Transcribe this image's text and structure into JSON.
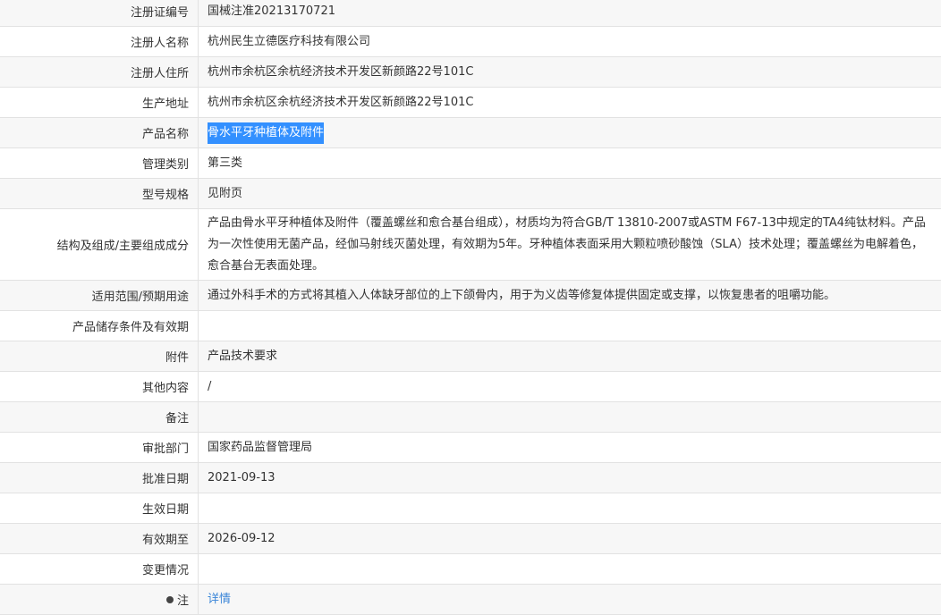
{
  "rows": [
    {
      "label": "注册证编号",
      "value": "国械注准20213170721"
    },
    {
      "label": "注册人名称",
      "value": "杭州民生立德医疗科技有限公司"
    },
    {
      "label": "注册人住所",
      "value": "杭州市余杭区余杭经济技术开发区新颜路22号101C"
    },
    {
      "label": "生产地址",
      "value": "杭州市余杭区余杭经济技术开发区新颜路22号101C"
    },
    {
      "label": "产品名称",
      "value": "骨水平牙种植体及附件"
    },
    {
      "label": "管理类别",
      "value": "第三类"
    },
    {
      "label": "型号规格",
      "value": "见附页"
    },
    {
      "label": "结构及组成/主要组成成分",
      "value": "产品由骨水平牙种植体及附件（覆盖螺丝和愈合基台组成），材质均为符合GB/T 13810-2007或ASTM F67-13中规定的TA4纯钛材料。产品为一次性使用无菌产品，经伽马射线灭菌处理，有效期为5年。牙种植体表面采用大颗粒喷砂酸蚀（SLA）技术处理；覆盖螺丝为电解着色，愈合基台无表面处理。"
    },
    {
      "label": "适用范围/预期用途",
      "value": "通过外科手术的方式将其植入人体缺牙部位的上下颌骨内，用于为义齿等修复体提供固定或支撑，以恢复患者的咀嚼功能。"
    },
    {
      "label": "产品储存条件及有效期",
      "value": ""
    },
    {
      "label": "附件",
      "value": "产品技术要求"
    },
    {
      "label": "其他内容",
      "value": "/"
    },
    {
      "label": "备注",
      "value": ""
    },
    {
      "label": "审批部门",
      "value": "国家药品监督管理局"
    },
    {
      "label": "批准日期",
      "value": "2021-09-13"
    },
    {
      "label": "生效日期",
      "value": ""
    },
    {
      "label": "有效期至",
      "value": "2026-09-12"
    },
    {
      "label": "变更情况",
      "value": ""
    },
    {
      "label": "注",
      "value": "详情"
    }
  ],
  "colors": {
    "highlight": "#3390ff",
    "link": "#3b86d8",
    "row_alt": "#f7f7f7",
    "border": "#e2e2e2"
  }
}
